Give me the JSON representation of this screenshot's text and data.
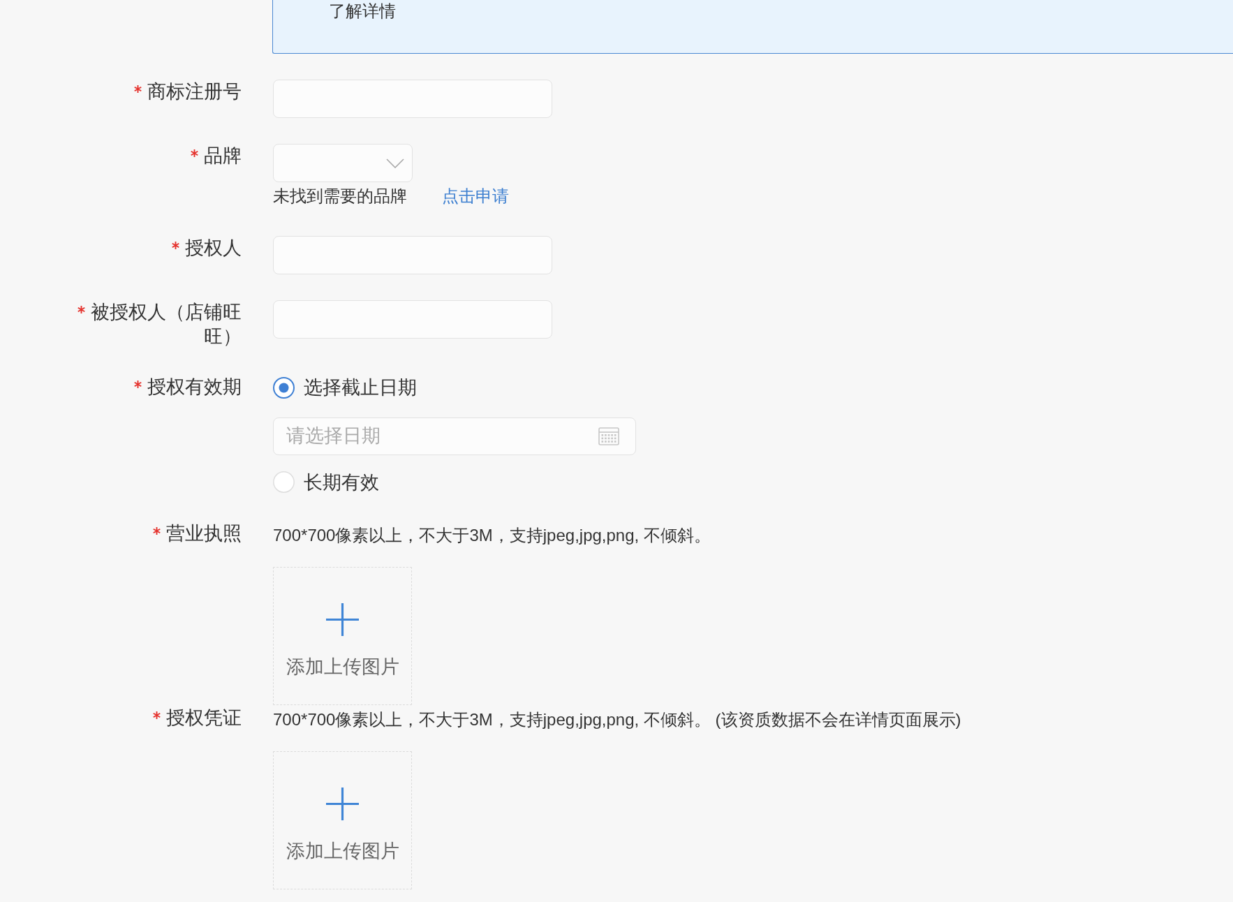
{
  "notice": {
    "text": "了解详情"
  },
  "form": {
    "fields": [
      {
        "kind": "text",
        "label": "商标注册号",
        "required": true
      },
      {
        "kind": "select",
        "label": "品牌",
        "required": true,
        "hint": "未找到需要的品牌",
        "link": "点击申请"
      },
      {
        "kind": "text",
        "label": "授权人",
        "required": true
      },
      {
        "kind": "text",
        "label": "被授权人（店铺旺旺）",
        "required": true
      },
      {
        "kind": "radio",
        "label": "授权有效期",
        "required": true,
        "options": [
          {
            "label": "选择截止日期",
            "selected": true,
            "date_field": {
              "placeholder": "请选择日期"
            }
          },
          {
            "label": "长期有效",
            "selected": false
          }
        ]
      },
      {
        "kind": "upload",
        "label": "营业执照",
        "required": true,
        "hint": "700*700像素以上，不大于3M，支持jpeg,jpg,png, 不倾斜。",
        "button": "添加上传图片"
      },
      {
        "kind": "upload",
        "label": "授权凭证",
        "required": true,
        "hint": "700*700像素以上，不大于3M，支持jpeg,jpg,png, 不倾斜。 (该资质数据不会在详情页面展示)",
        "button": "添加上传图片"
      }
    ]
  }
}
